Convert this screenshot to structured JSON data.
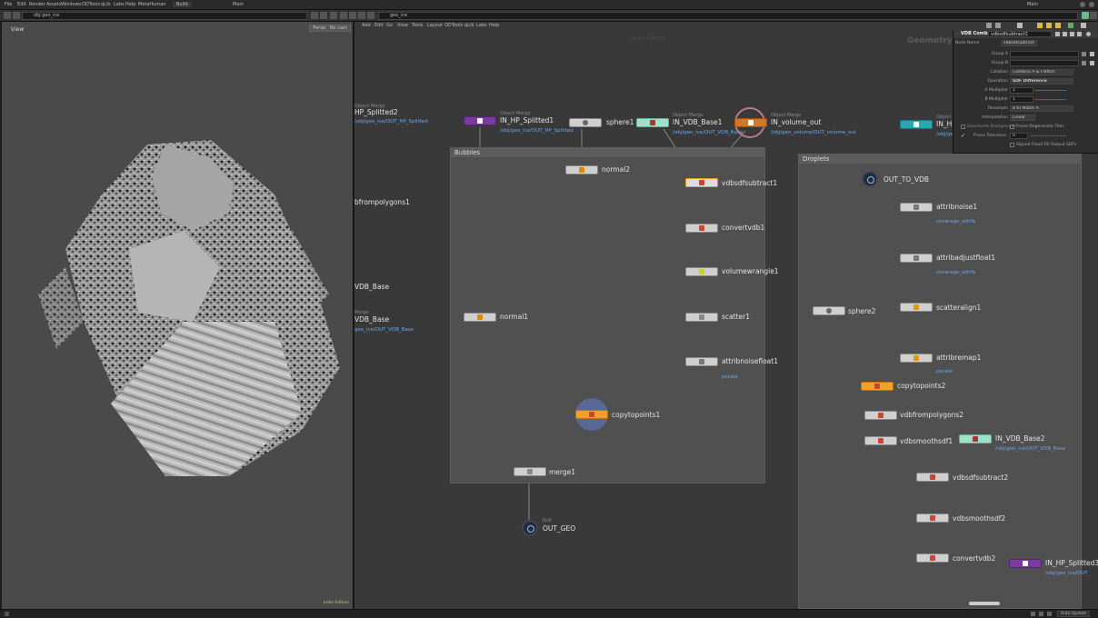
{
  "menu": [
    "File",
    "Edit",
    "Render",
    "Assets",
    "Windows",
    "ODTools",
    "qLib",
    "Labs",
    "Help",
    "MetaHuman"
  ],
  "tabs": {
    "left": "Build",
    "right": "Main",
    "corner": "Main"
  },
  "viewport": {
    "label": "View",
    "btn1": "Persp",
    "btn2": "No cam",
    "status": "Indie Edition"
  },
  "path": {
    "left": "obj   geo_ice",
    "right": "geo_ice"
  },
  "netmenu": [
    "Add",
    "Edit",
    "Go",
    "View",
    "Tools",
    "Layout",
    "ODTools",
    "qLib",
    "Labs",
    "Help"
  ],
  "network": {
    "mode_left": "Indie Edition",
    "context": "Geometry",
    "boxes": {
      "bubbles": "Bubbles",
      "droplets": "Droplets"
    },
    "nodes": {
      "in_hp_splitted1": {
        "name": "IN_HP_Splitted1",
        "type": "Object Merge",
        "path": "/obj/geo_ice/OUT_HP_Splitted"
      },
      "sphere1": {
        "name": "sphere1"
      },
      "in_vdb_base1": {
        "name": "IN_VDB_Base1",
        "type": "Object Merge",
        "path": "/obj/geo_ice/OUT_VDB_Base"
      },
      "in_volume_out": {
        "name": "IN_volume_out",
        "type": "Object Merge",
        "path": "/obj/geo_volume/OUT_volume_out"
      },
      "in_hp_partial": {
        "name": "IN_HF",
        "type": "Object Merge",
        "path": "/obj/ge"
      },
      "hp_splitted2": {
        "name": "HP_Splitted2",
        "type": "Object Merge",
        "path": "/obj/geo_ice/OUT_HP_Splitted"
      },
      "frompolygons1": {
        "name": "bfrompolygons1"
      },
      "vdb_base": {
        "name": "VDB_Base"
      },
      "vdb_base2": {
        "name": "VDB_Base",
        "type": "Merge",
        "path": "geo_ice/OUT_VDB_Base"
      },
      "normal2": {
        "name": "normal2"
      },
      "vdbsdfsubtract1": {
        "name": "vdbsdfsubtract1"
      },
      "convertvdb1": {
        "name": "convertvdb1"
      },
      "volumewrangle1": {
        "name": "volumewrangle1"
      },
      "scatter1": {
        "name": "scatter1"
      },
      "attribnoisefloat1": {
        "name": "attribnoisefloat1",
        "note": "pscale"
      },
      "normal1": {
        "name": "normal1"
      },
      "copytopoints1": {
        "name": "copytopoints1"
      },
      "merge1": {
        "name": "merge1"
      },
      "out_geo": {
        "name": "OUT_GEO",
        "type": "Null"
      },
      "out_to_vdb": {
        "name": "OUT_TO_VDB"
      },
      "attribnoise1": {
        "name": "attribnoise1",
        "note": "coverage_attrib"
      },
      "attribadjustfloat1": {
        "name": "attribadjustfloat1",
        "note": "coverage_attrib"
      },
      "sphere2": {
        "name": "sphere2"
      },
      "scatteralign1": {
        "name": "scatteralign1"
      },
      "attribremap1": {
        "name": "attribremap1",
        "note": "pscale"
      },
      "copytopoints2": {
        "name": "copytopoints2"
      },
      "vdbfrompolygons2": {
        "name": "vdbfrompolygons2"
      },
      "vdbsmoothsdf1": {
        "name": "vdbsmoothsdf1"
      },
      "in_vdb_base2": {
        "name": "IN_VDB_Base2",
        "path": "/obj/geo_ice/OUT_VDB_Base"
      },
      "vdbsdfsubtract2": {
        "name": "vdbsdfsubtract2"
      },
      "vdbsmoothsdf2": {
        "name": "vdbsmoothsdf2"
      },
      "convertvdb2": {
        "name": "convertvdb2"
      },
      "in_hp_splitted3": {
        "name": "IN_HP_Splitted3",
        "path": "/obj/geo_ice/OUT_"
      }
    }
  },
  "params": {
    "header_type": "VDB Combine",
    "header_name": "vdbsdfsubtract1",
    "top_label": "Node Name",
    "top_value": "vdbsdfsubtract",
    "rows": [
      {
        "label": "Group A",
        "value": ""
      },
      {
        "label": "Group B",
        "value": ""
      },
      {
        "label": "Collation",
        "value": "Combine A & Flatten"
      },
      {
        "label": "Operation",
        "value": "SDF Difference"
      },
      {
        "label": "A Multiplier",
        "value": "1"
      },
      {
        "label": "B Multiplier",
        "value": "1"
      },
      {
        "label": "Resample",
        "value": "B to Match A"
      },
      {
        "label": "Interpolation",
        "value": "Linear"
      }
    ],
    "check1": "Deactivate Background",
    "check2": "Prune Degenerate Tiles",
    "check3": "Prune Tolerance",
    "prune_value": "0",
    "check4": "Signed Flood Fill Output SDFs"
  },
  "status": {
    "right": "Auto Update"
  }
}
